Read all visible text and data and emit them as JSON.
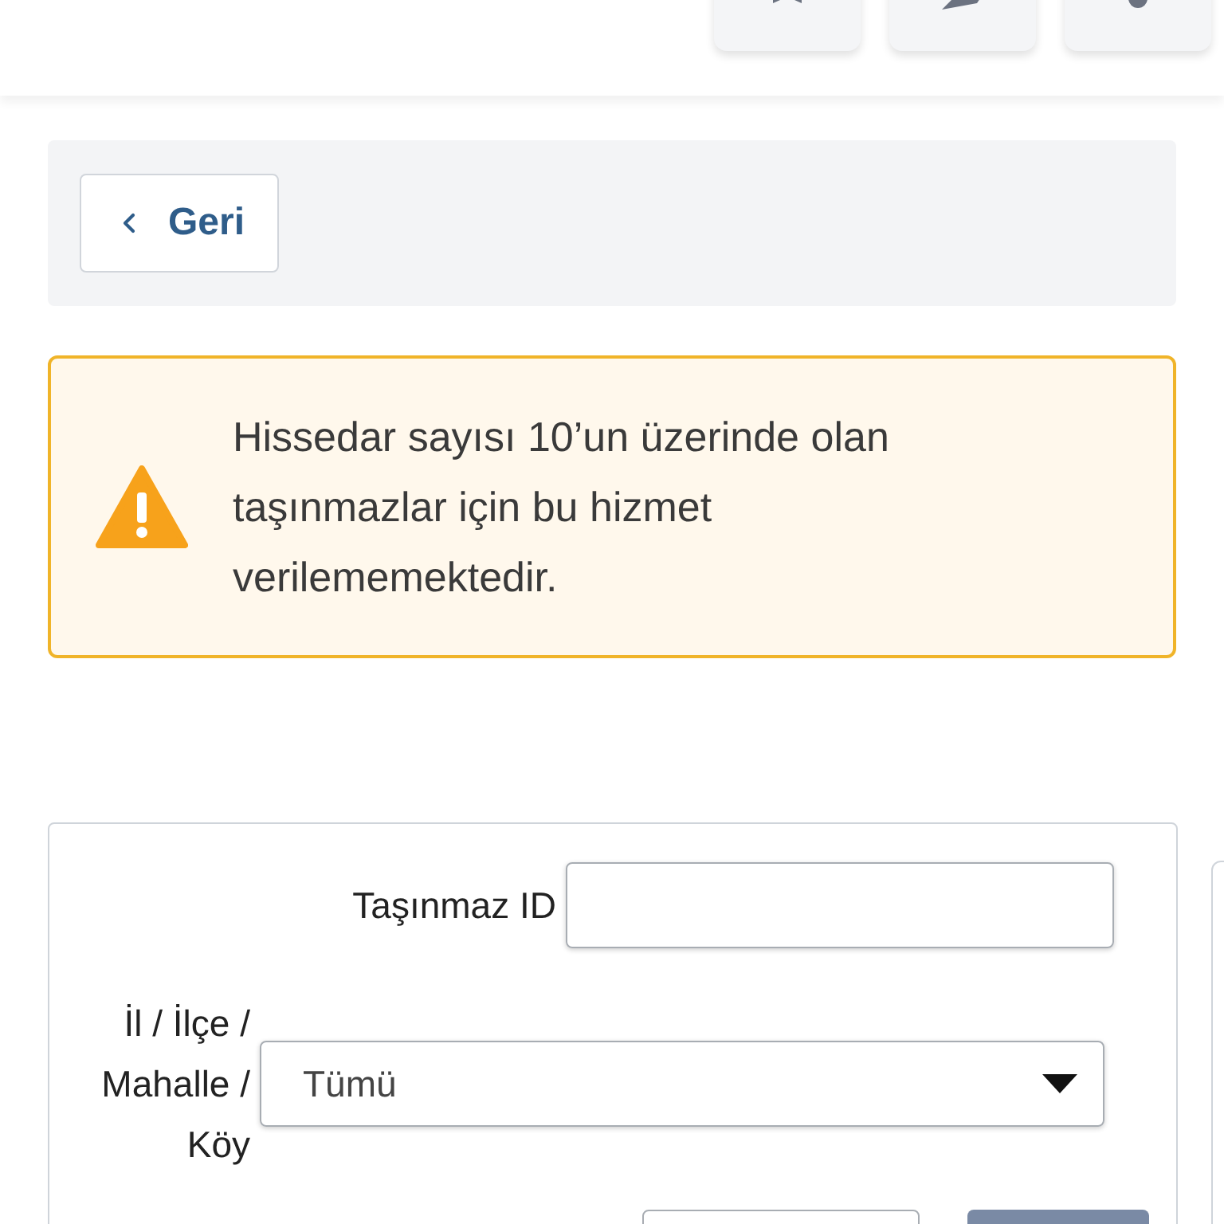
{
  "back_button": {
    "label": "Geri"
  },
  "warning": {
    "text": "Hissedar sayısı 10’un üzerinde olan taşınmazlar için bu hizmet verilememektedir."
  },
  "form": {
    "fields": [
      {
        "kind": "text",
        "label": "Taşınmaz ID"
      },
      {
        "kind": "select",
        "label": "İl / İlçe / Mahalle / Köy",
        "value": "Tümü"
      }
    ]
  }
}
